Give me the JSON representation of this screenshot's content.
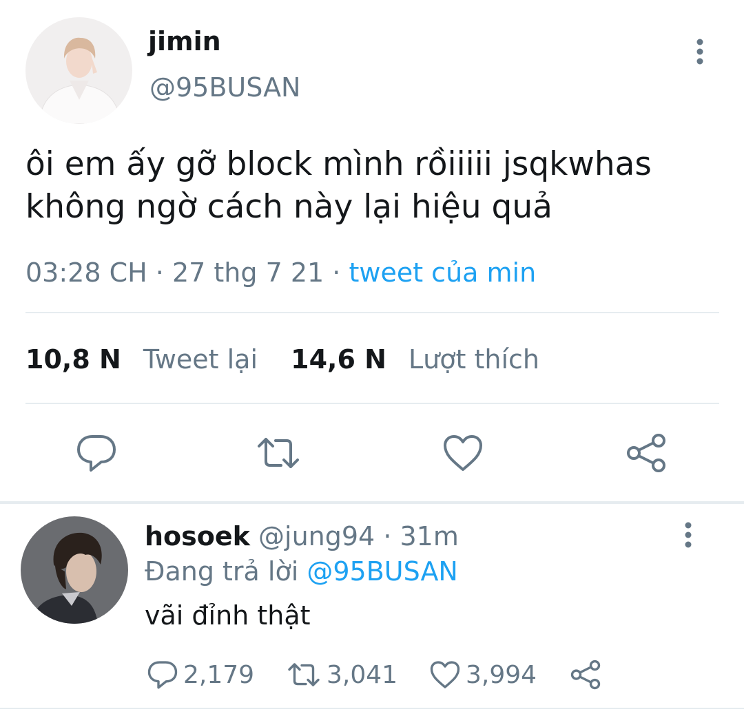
{
  "tweet": {
    "display_name": "jimin",
    "handle": "@95BUSAN",
    "text_lines": [
      "ôi em ấy gỡ block mình rồiiiii jsqkwhas",
      "không ngờ cách này lại hiệu quả"
    ],
    "time": "03:28 CH",
    "date": "27 thg 7 21",
    "source": "tweet của min",
    "retweet_count": "10,8 N",
    "retweet_label": "Tweet lại",
    "like_count": "14,6 N",
    "like_label": "Lượt thích",
    "actions": [
      "reply-icon",
      "retweet-icon",
      "like-icon",
      "share-icon"
    ]
  },
  "reply": {
    "display_name": "hosoek",
    "handle": "@jung94",
    "time": "31m",
    "replying_prefix": "Đang trả lời",
    "replying_to": "@95BUSAN",
    "text": "vãi đỉnh thật",
    "reply_count": "2,179",
    "retweet_count": "3,041",
    "like_count": "3,994"
  },
  "colors": {
    "text": "#14171a",
    "secondary": "#657786",
    "accent": "#1da1f2",
    "divider": "#e6ecf0"
  }
}
